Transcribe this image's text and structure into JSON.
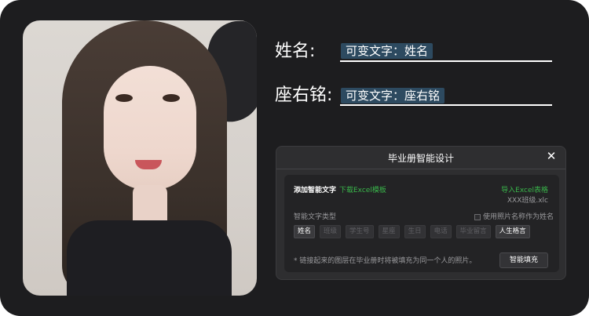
{
  "fields": {
    "name_label": "姓名:",
    "name_tag": "可变文字：姓名",
    "motto_label": "座右铭:",
    "motto_tag": "可变文字：座右铭"
  },
  "dialog": {
    "title": "毕业册智能设计",
    "add_text_label": "添加智能文字",
    "download_template_link": "下载Excel模板",
    "import_excel_link": "导入Excel表格",
    "file_name": "XXX班级.xlc",
    "type_label": "智能文字类型",
    "use_photo_name_label": "使用照片名称作为姓名",
    "chips": [
      {
        "label": "姓名",
        "active": true
      },
      {
        "label": "班级",
        "active": false
      },
      {
        "label": "学生号",
        "active": false
      },
      {
        "label": "星座",
        "active": false
      },
      {
        "label": "生日",
        "active": false
      },
      {
        "label": "电话",
        "active": false
      },
      {
        "label": "毕业留言",
        "active": false
      },
      {
        "label": "人生格言",
        "active": true
      }
    ],
    "footer_note": "* 链接起来的图层在毕业册时将被填充为同一个人的照片。",
    "fill_button": "智能填充"
  },
  "icons": {
    "close": "close-icon"
  }
}
